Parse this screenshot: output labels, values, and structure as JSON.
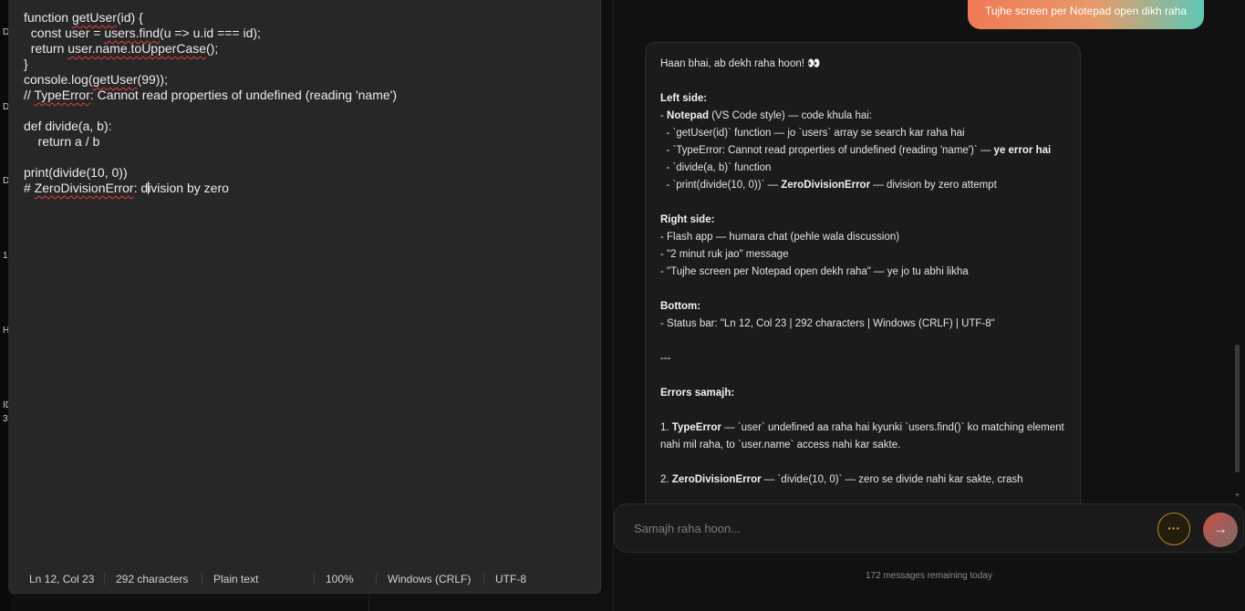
{
  "background": {
    "left_edge_chars": [
      "D",
      "D",
      "D",
      "1",
      "H",
      "ID",
      "3"
    ]
  },
  "notepad": {
    "lines": [
      [
        {
          "t": "function "
        },
        {
          "t": "getUser",
          "sq": true
        },
        {
          "t": "(id) {"
        }
      ],
      [
        {
          "t": "  const user = "
        },
        {
          "t": "users.find",
          "sq": true
        },
        {
          "t": "(u => u.id === id);"
        }
      ],
      [
        {
          "t": "  return "
        },
        {
          "t": "user.name.toUpperCase",
          "sq": true
        },
        {
          "t": "();"
        }
      ],
      [
        {
          "t": "}"
        }
      ],
      [
        {
          "t": "console.log("
        },
        {
          "t": "getUser",
          "sq": true
        },
        {
          "t": "(99));"
        }
      ],
      [
        {
          "t": "// "
        },
        {
          "t": "TypeError",
          "sq": true
        },
        {
          "t": ": Cannot read properties of undefined (reading 'name')"
        }
      ],
      [
        {
          "t": ""
        }
      ],
      [
        {
          "t": "def divide(a, b):"
        }
      ],
      [
        {
          "t": "    return a / b"
        }
      ],
      [
        {
          "t": ""
        }
      ],
      [
        {
          "t": "print(divide(10, 0))"
        }
      ],
      [
        {
          "t": "# "
        },
        {
          "t": "ZeroDivisionError",
          "sq": true
        },
        {
          "t": ": d"
        },
        {
          "caret": true
        },
        {
          "t": "ivision by zero"
        }
      ]
    ],
    "status": {
      "position": "Ln 12, Col 23",
      "characters": "292 characters",
      "type": "Plain text",
      "zoom": "100%",
      "line_endings": "Windows (CRLF)",
      "encoding": "UTF-8"
    }
  },
  "chat": {
    "user_message": "Tujhe screen per Notepad open dikh raha",
    "ai_message_lines": [
      [
        {
          "t": "Haan bhai, ab dekh raha hoon! 👀"
        }
      ],
      [],
      [
        {
          "t": "Left side:",
          "b": true
        }
      ],
      [
        {
          "t": "- "
        },
        {
          "t": "Notepad",
          "b": true
        },
        {
          "t": " (VS Code style) — code khula hai:"
        }
      ],
      [
        {
          "t": "  - `getUser(id)` function — jo `users` array se search kar raha hai"
        }
      ],
      [
        {
          "t": "  - `TypeError: Cannot read properties of undefined (reading 'name')` — "
        },
        {
          "t": "ye error hai",
          "b": true
        }
      ],
      [
        {
          "t": "  - `divide(a, b)` function"
        }
      ],
      [
        {
          "t": "  - `print(divide(10, 0))` — "
        },
        {
          "t": "ZeroDivisionError",
          "b": true
        },
        {
          "t": " — division by zero attempt"
        }
      ],
      [],
      [
        {
          "t": "Right side:",
          "b": true
        }
      ],
      [
        {
          "t": "- Flash app — humara chat (pehle wala discussion)"
        }
      ],
      [
        {
          "t": "- \"2 minut ruk jao\" message"
        }
      ],
      [
        {
          "t": "- \"Tujhe screen per Notepad open dekh raha\" — ye jo tu abhi likha"
        }
      ],
      [],
      [
        {
          "t": "Bottom:",
          "b": true
        }
      ],
      [
        {
          "t": "- Status bar: \"Ln 12, Col 23 | 292 characters | Windows (CRLF) | UTF-8\""
        }
      ],
      [],
      [
        {
          "t": "---"
        }
      ],
      [],
      [
        {
          "t": "Errors samajh:",
          "b": true
        }
      ],
      [],
      [
        {
          "t": "1. "
        },
        {
          "t": "TypeError",
          "b": true
        },
        {
          "t": " — `user` undefined aa raha hai kyunki `users.find()` ko matching element nahi mil raha, to `user.name` access nahi kar sakte."
        }
      ],
      [],
      [
        {
          "t": "2. "
        },
        {
          "t": "ZeroDivisionError",
          "b": true
        },
        {
          "t": " — `divide(10, 0)` — zero se divide nahi kar sakte, crash"
        }
      ]
    ],
    "input_placeholder": "Samajh raha hoon...",
    "more_button": "···",
    "send_button": "→",
    "remaining_text": "172 messages remaining today"
  }
}
